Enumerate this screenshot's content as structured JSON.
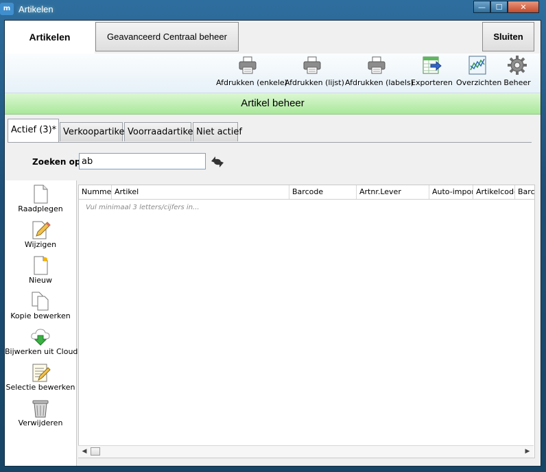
{
  "window": {
    "title": "Artikelen",
    "app_icon": "app-logo",
    "controls": {
      "minimize": "—",
      "maximize": "☐",
      "close": "✕"
    }
  },
  "topbar": {
    "tab_label": "Artikelen",
    "advanced_button": "Geavanceerd Centraal beheer",
    "close_button": "Sluiten"
  },
  "toolbar": {
    "items": [
      {
        "label": "Afdrukken (enkele)",
        "icon": "printer-icon"
      },
      {
        "label": "Afdrukken (lijst)",
        "icon": "printer-icon"
      },
      {
        "label": "Afdrukken (labels)",
        "icon": "printer-icon"
      },
      {
        "label": "Exporteren",
        "icon": "export-icon"
      },
      {
        "label": "Overzichten",
        "icon": "chart-icon"
      },
      {
        "label": "Beheer",
        "icon": "gear-icon"
      }
    ]
  },
  "header_banner": "Artikel beheer",
  "tabs": [
    {
      "label": "Actief (3)*",
      "active": true
    },
    {
      "label": "Verkoopartikel",
      "active": false
    },
    {
      "label": "Voorraadartikel",
      "active": false
    },
    {
      "label": "Niet actief",
      "active": false
    }
  ],
  "search": {
    "label": "Zoeken op:",
    "value": "ab"
  },
  "actions": [
    {
      "label": "Raadplegen",
      "icon": "document-icon"
    },
    {
      "label": "Wijzigen",
      "icon": "edit-icon"
    },
    {
      "label": "Nieuw",
      "icon": "new-document-icon"
    },
    {
      "label": "Kopie bewerken",
      "icon": "copy-icon"
    },
    {
      "label": "Bijwerken uit Cloud",
      "icon": "cloud-download-icon"
    },
    {
      "label": "Selectie bewerken",
      "icon": "list-edit-icon"
    },
    {
      "label": "Verwijderen",
      "icon": "trash-icon"
    }
  ],
  "grid": {
    "columns": [
      "Nummer",
      "Artikel",
      "Barcode",
      "Artnr.Lever",
      "Auto-import",
      "Artikelcode",
      "Barco"
    ],
    "hint": "Vul minimaal 3 letters/cijfers in..."
  },
  "colors": {
    "banner_green": "#a9e89a",
    "window_blue": "#1d4f77"
  }
}
